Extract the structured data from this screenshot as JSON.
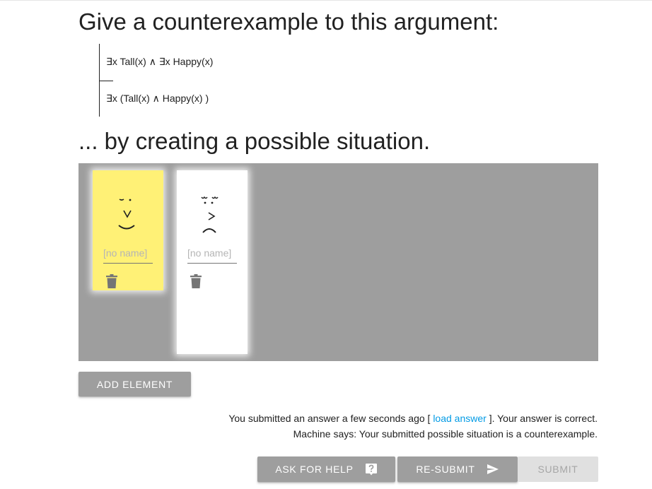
{
  "page": {
    "title": "Give a counterexample to this argument:",
    "subtitle": "... by creating a possible situation."
  },
  "argument": {
    "premise": "∃x Tall(x) ∧ ∃x Happy(x)",
    "conclusion": "∃x (Tall(x) ∧ Happy(x) )"
  },
  "world": {
    "elements": [
      {
        "name_placeholder": "[no name]",
        "name_value": "",
        "color": "#fff176",
        "face": "happy-face",
        "delete_icon": "trash-icon"
      },
      {
        "name_placeholder": "[no name]",
        "name_value": "",
        "color": "#ffffff",
        "face": "sad-face",
        "delete_icon": "trash-icon"
      }
    ],
    "background_color": "#9e9e9e"
  },
  "buttons": {
    "add_element": "ADD ELEMENT",
    "ask_for_help": "ASK FOR HELP",
    "ask_for_help_icon": "help-icon",
    "resubmit": "RE-SUBMIT",
    "resubmit_icon": "send-icon",
    "submit": "SUBMIT"
  },
  "status": {
    "line1_before": "You submitted an answer a few seconds ago [",
    "load_answer_link": "load answer",
    "line1_after": "]. Your answer is correct.",
    "line2": "Machine says: Your submitted possible situation is a counterexample."
  },
  "colors": {
    "link": "#039be5",
    "button_bg": "#9e9e9e",
    "button_disabled_bg": "#e0e0e0",
    "highlight_card": "#fff176"
  }
}
